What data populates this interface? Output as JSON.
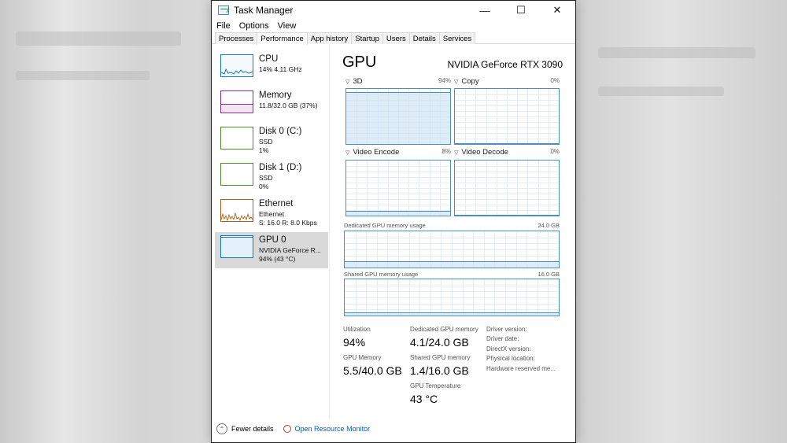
{
  "window": {
    "title": "Task Manager",
    "controls": {
      "minimize": "—",
      "maximize": "☐",
      "close": "✕"
    }
  },
  "menu": [
    "File",
    "Options",
    "View"
  ],
  "tabs": [
    "Processes",
    "Performance",
    "App history",
    "Startup",
    "Users",
    "Details",
    "Services"
  ],
  "active_tab": "Performance",
  "sidebar": [
    {
      "title": "CPU",
      "line1": "14%  4.11 GHz",
      "line2": "",
      "color": "#1779ba"
    },
    {
      "title": "Memory",
      "line1": "11.8/32.0 GB (37%)",
      "line2": "",
      "color": "#8b2f8a"
    },
    {
      "title": "Disk 0 (C:)",
      "line1": "SSD",
      "line2": "1%",
      "color": "#4d8c26"
    },
    {
      "title": "Disk 1 (D:)",
      "line1": "SSD",
      "line2": "0%",
      "color": "#4d8c26"
    },
    {
      "title": "Ethernet",
      "line1": "Ethernet",
      "line2": "S: 16.0  R: 8.0 Kbps",
      "color": "#a65c1a"
    },
    {
      "title": "GPU 0",
      "line1": "NVIDIA GeForce R...",
      "line2": "94%  (43 °C)",
      "color": "#1779ba"
    }
  ],
  "main": {
    "title": "GPU",
    "model": "NVIDIA GeForce RTX 3090",
    "engines": [
      {
        "name": "3D",
        "pct": "94%",
        "level": 0.94
      },
      {
        "name": "Copy",
        "pct": "0%",
        "level": 0.0
      },
      {
        "name": "Video Encode",
        "pct": "8%",
        "level": 0.08
      },
      {
        "name": "Video Decode",
        "pct": "0%",
        "level": 0.0
      }
    ],
    "dedicated": {
      "label": "Dedicated GPU memory usage",
      "max": "24.0 GB",
      "level": 0.17
    },
    "shared": {
      "label": "Shared GPU memory usage",
      "max": "16.0 GB",
      "level": 0.09
    },
    "stats": {
      "utilization_label": "Utilization",
      "utilization": "94%",
      "dedicated_label": "Dedicated GPU memory",
      "dedicated": "4.1/24.0 GB",
      "gpu_memory_label": "GPU Memory",
      "gpu_memory": "5.5/40.0 GB",
      "shared_label": "Shared GPU memory",
      "shared": "1.4/16.0 GB",
      "temp_label": "GPU Temperature",
      "temp": "43 °C"
    },
    "info": [
      "Driver version:",
      "Driver date:",
      "DirectX version:",
      "Physical location:",
      "Hardware reserved me..."
    ]
  },
  "footer": {
    "fewer": "Fewer details",
    "monitor": "Open Resource Monitor"
  }
}
